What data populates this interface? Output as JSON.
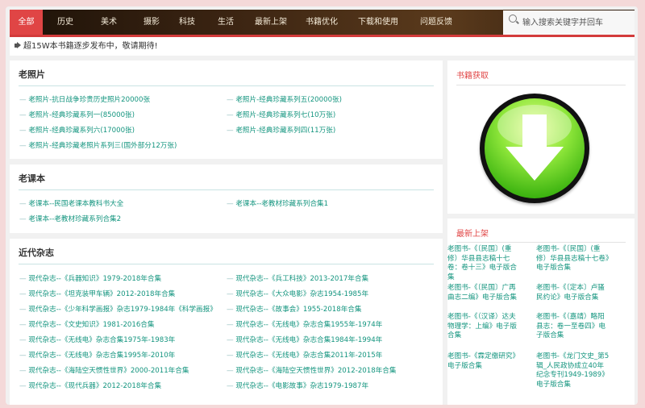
{
  "nav": {
    "items": [
      "全部",
      "历史",
      "美术",
      "摄影",
      "科技",
      "生活",
      "最新上架",
      "书籍优化",
      "下载和使用",
      "问题反馈"
    ],
    "search_placeholder": "输入搜索关键字并回车"
  },
  "notice": "超15W本书籍逐步发布中，敬请期待!",
  "sections": [
    {
      "title": "老照片",
      "links": [
        "老照片-抗日战争珍贵历史照片20000张",
        "老照片-经典珍藏系列五(20000张)",
        "老照片-经典珍藏系列一(85000张)",
        "老照片-经典珍藏系列七(10万张)",
        "老照片-经典珍藏系列六(17000张)",
        "老照片-经典珍藏系列四(11万张)",
        "老照片-经典珍藏老照片系列三(国外部分12万张)"
      ]
    },
    {
      "title": "老课本",
      "links": [
        "老课本--民国老课本教科书大全",
        "老课本--老教材珍藏系列合集1",
        "老课本--老教材珍藏系列合集2"
      ]
    },
    {
      "title": "近代杂志",
      "links": [
        "现代杂志--《兵器知识》1979-2018年合集",
        "现代杂志--《兵工科技》2013-2017年合集",
        "现代杂志--《坦克装甲车辆》2012-2018年合集",
        "现代杂志--《大众电影》杂志1954-1985年",
        "现代杂志--《少年科学画报》杂志1979-1984年《科学画报》",
        "现代杂志--《故事会》1955-2018年合集",
        "现代杂志--《文史知识》1981-2016合集",
        "现代杂志--《无线电》杂志合集1955年-1974年",
        "现代杂志--《无线电》杂志合集1975年-1983年",
        "现代杂志--《无线电》杂志合集1984年-1994年",
        "现代杂志--《无线电》杂志合集1995年-2010年",
        "现代杂志--《无线电》杂志合集2011年-2015年",
        "现代杂志--《海陆空天惯性世界》2000-2011年合集",
        "现代杂志--《海陆空天惯性世界》2012-2018年合集",
        "现代杂志--《现代兵器》2012-2018年合集",
        "现代杂志--《电影故事》杂志1979-1987年"
      ]
    }
  ],
  "sidebar": {
    "download_title": "书籍获取",
    "new_title": "最新上架",
    "new_items": [
      "老图书-《〔民国〕(重修）华县县志稿十七卷：卷十三》电子版合集",
      "老图书-《〔民国〕(重修）华县县志稿十七卷》电子版合集",
      "老图书-《〔民国〕广再曲志二编》电子版合集",
      "老图书-《〔定本〕卢骚民约论》电子版合集",
      "老图书-《（汉译）达夫物理学：上编》电子版合集",
      "老图书-《（嘉靖）略阳县志：卷一至卷四》电子版合集",
      "老图书-《霖定缴研究》电子版合集",
      "老图书-《龙门文史_第5辑_人民政协成立40年纪念专刊1949-1989》电子版合集"
    ]
  },
  "colors": {
    "accent": "#e04545",
    "link": "#14957f",
    "nav_bg": "#3b2412"
  }
}
